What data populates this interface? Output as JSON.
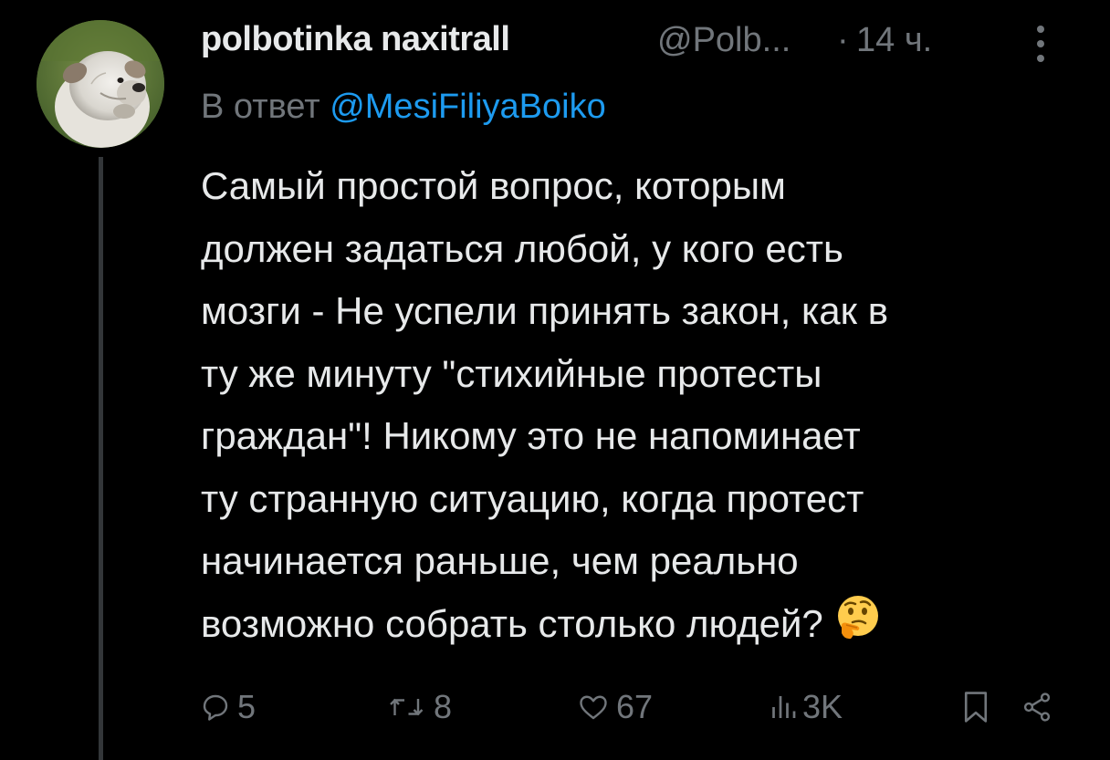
{
  "author": {
    "display_name": "polbotinka naxitrall",
    "handle": "@Polb...",
    "separator": "·",
    "time": "14 ч.",
    "avatar_icon": "bulldog-avatar"
  },
  "reply": {
    "prefix": "В ответ ",
    "mention": "@MesiFiliyaBoiko"
  },
  "tweet": {
    "text": "Самый простой вопрос, которым\nдолжен задаться любой, у кого есть\nмозги - Не успели принять закон, как в\nту же минуту \"стихийные протесты\nграждан\"! Никому это не напоминает\nту странную ситуацию, когда протест\nначинается раньше, чем реально\nвозможно собрать столько людей? ",
    "emoji": "thinking-face-emoji"
  },
  "actions": {
    "replies": "5",
    "reposts": "8",
    "likes": "67",
    "views": "3K"
  },
  "colors": {
    "background": "#000000",
    "text": "#e7e9ea",
    "muted": "#71767b",
    "link": "#1d9bf0",
    "thread_line": "#333639"
  }
}
